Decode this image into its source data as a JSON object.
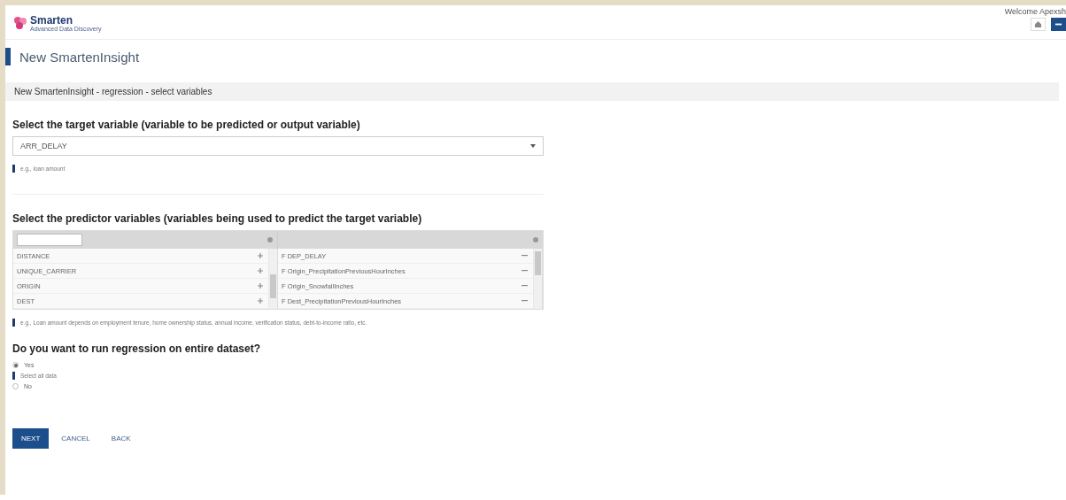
{
  "header": {
    "logo_name": "Smarten",
    "logo_tagline": "Advanced Data Discovery",
    "welcome": "Welcome Apexsh"
  },
  "page_title": "New SmartenInsight",
  "breadcrumb": "New SmartenInsight - regression - select variables",
  "target": {
    "heading": "Select the target variable (variable to be predicted or output variable)",
    "value": "ARR_DELAY",
    "hint": "e.g., loan amount"
  },
  "predictors": {
    "heading": "Select the predictor variables (variables being used to predict the target variable)",
    "available": [
      {
        "name": "DISTANCE"
      },
      {
        "name": "UNIQUE_CARRIER"
      },
      {
        "name": "ORIGIN"
      },
      {
        "name": "DEST"
      }
    ],
    "selected": [
      {
        "type": "F",
        "name": "DEP_DELAY"
      },
      {
        "type": "F",
        "name": "Origin_PrecipitationPreviousHourInches"
      },
      {
        "type": "F",
        "name": "Origin_SnowfallInches"
      },
      {
        "type": "F",
        "name": "Dest_PrecipitationPreviousHourInches"
      }
    ],
    "hint": "e.g., Loan amount depends on employment tenure, home ownership status, annual income, verification status, debt-to-income ratio, etc."
  },
  "dataset": {
    "question": "Do you want to run regression on entire dataset?",
    "options": [
      {
        "label": "Yes",
        "selected": true,
        "hint": "Select all data"
      },
      {
        "label": "No",
        "selected": false
      }
    ]
  },
  "buttons": [
    {
      "label": "NEXT",
      "kind": "primary"
    },
    {
      "label": "CANCEL",
      "kind": "link"
    },
    {
      "label": "BACK",
      "kind": "link"
    }
  ]
}
